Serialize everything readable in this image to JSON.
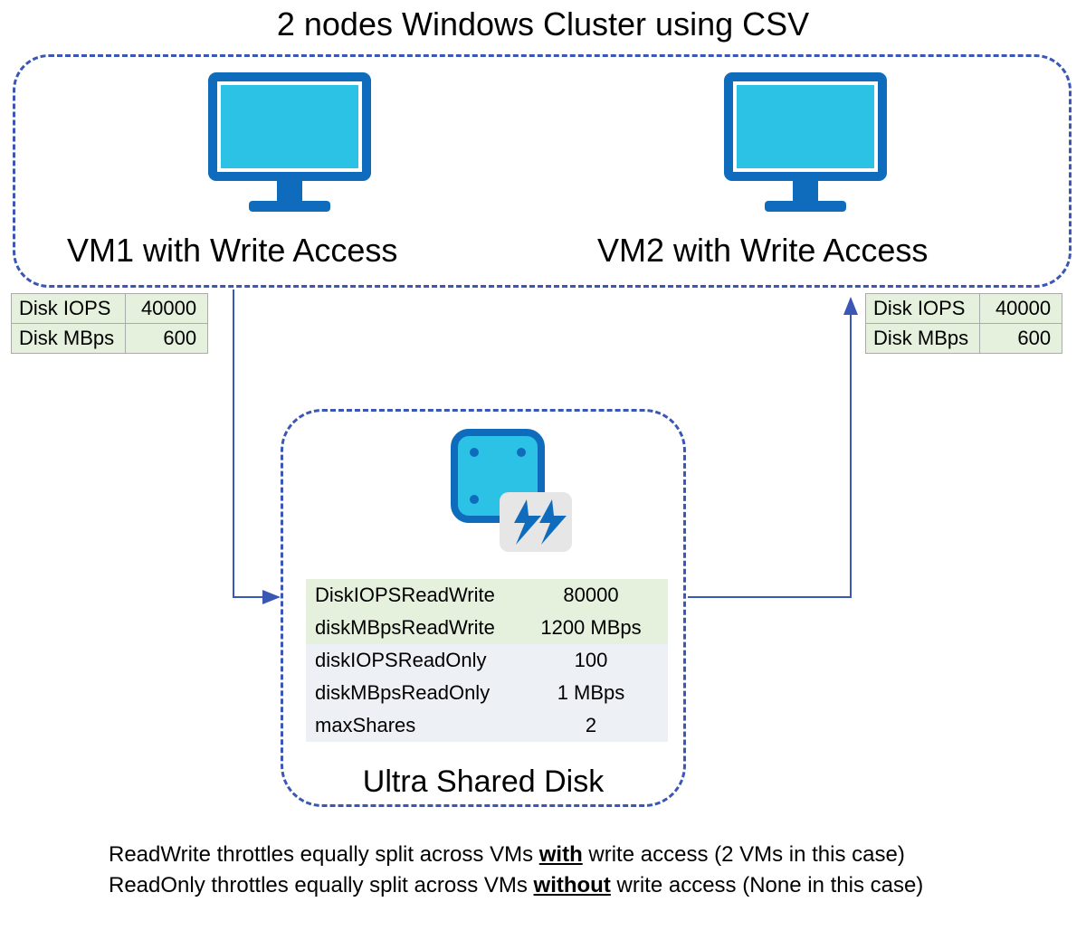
{
  "title": "2 nodes Windows Cluster using CSV",
  "vm1": {
    "label": "VM1 with Write Access"
  },
  "vm2": {
    "label": "VM2 with Write Access"
  },
  "vm1_table": {
    "iops_label": "Disk IOPS",
    "iops_value": "40000",
    "mbps_label": "Disk MBps",
    "mbps_value": "600"
  },
  "vm2_table": {
    "iops_label": "Disk IOPS",
    "iops_value": "40000",
    "mbps_label": "Disk MBps",
    "mbps_value": "600"
  },
  "disk": {
    "title": "Ultra Shared Disk",
    "rows": {
      "r1k": "DiskIOPSReadWrite",
      "r1v": "80000",
      "r2k": "diskMBpsReadWrite",
      "r2v": "1200 MBps",
      "r3k": "diskIOPSReadOnly",
      "r3v": "100",
      "r4k": "diskMBpsReadOnly",
      "r4v": "1 MBps",
      "r5k": "maxShares",
      "r5v": "2"
    }
  },
  "footer": {
    "line1_a": "ReadWrite throttles equally split across VMs ",
    "line1_bold": "with",
    "line1_b": " write access (2 VMs in this case)",
    "line2_a": "ReadOnly throttles equally split across VMs ",
    "line2_bold": "without",
    "line2_b": " write access (None in this case)"
  }
}
